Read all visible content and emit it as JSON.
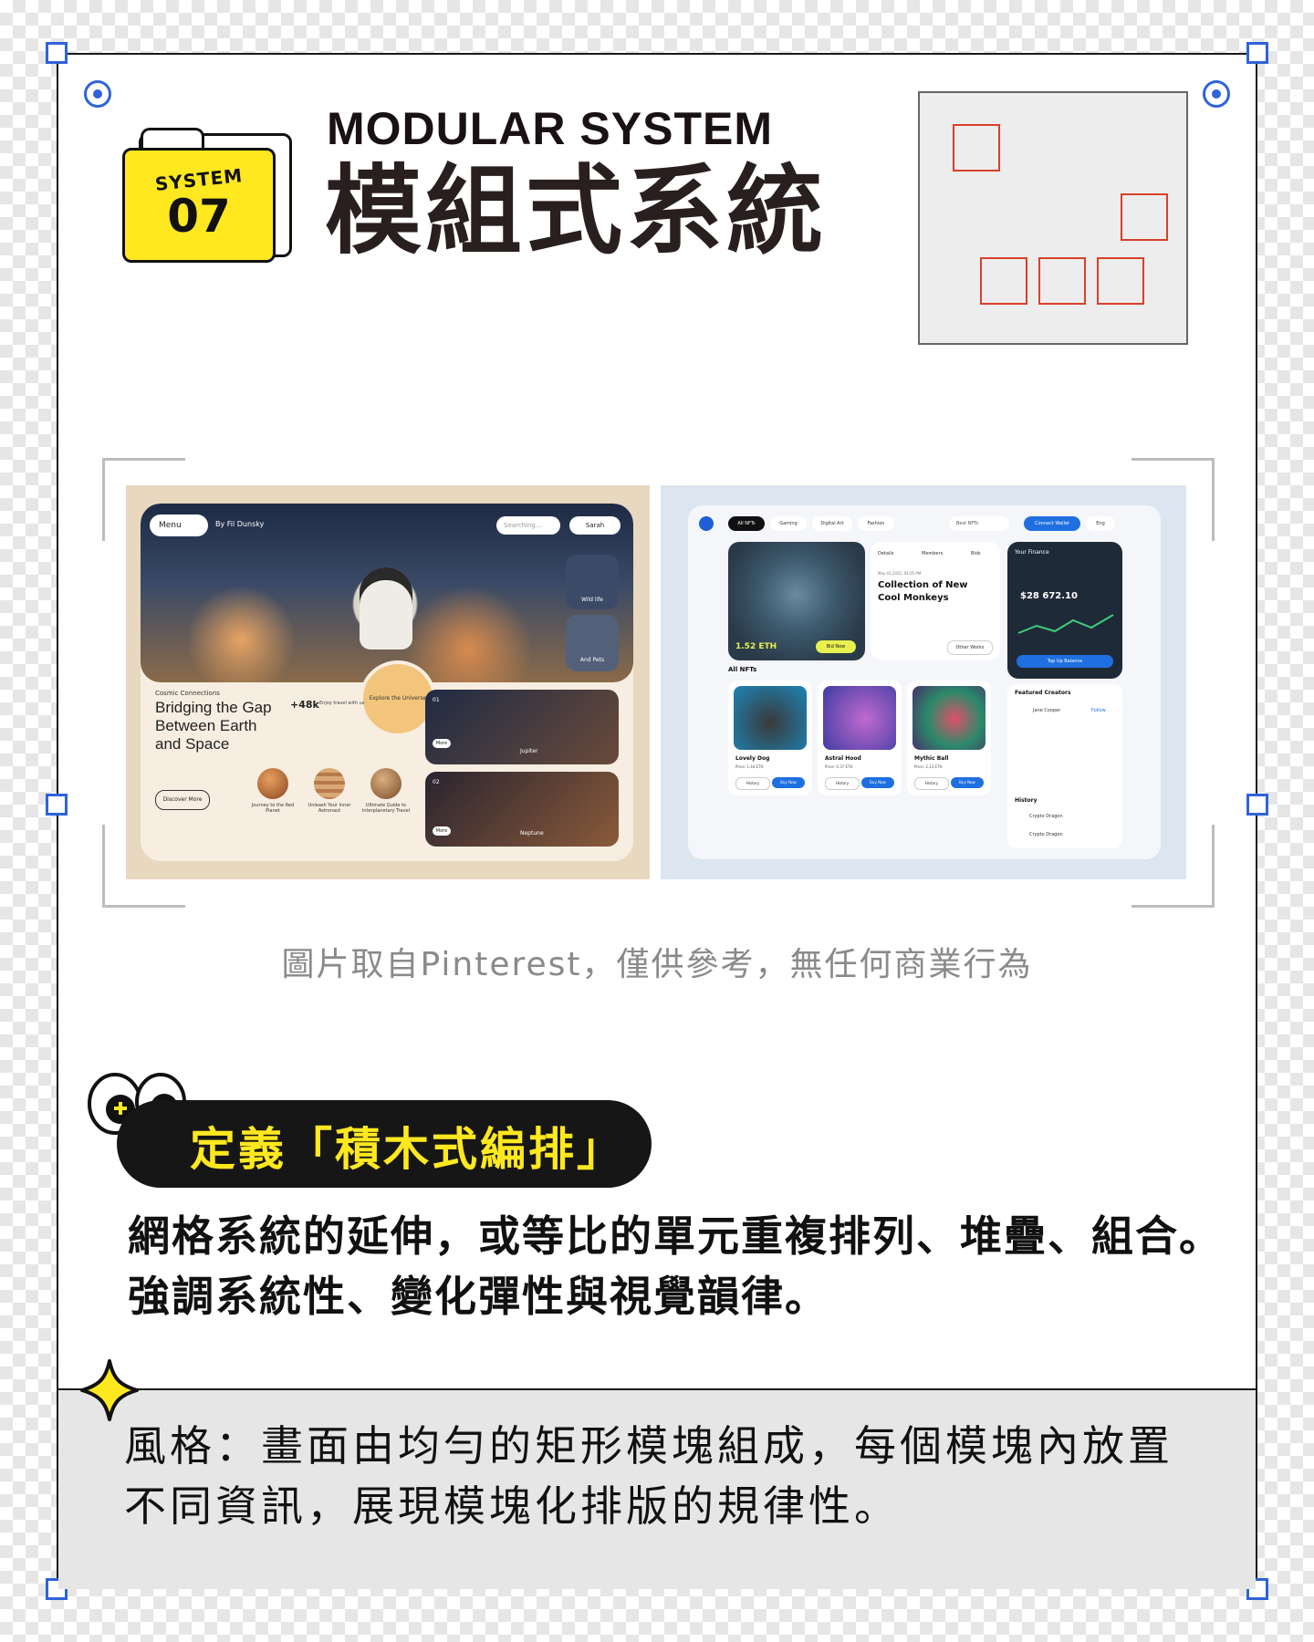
{
  "badge": {
    "line1": "SYSTEM",
    "line2": "07"
  },
  "title": {
    "english": "MODULAR SYSTEM",
    "chinese": "模組式系統"
  },
  "reference_images": {
    "left": {
      "menu": "Menu",
      "brand": "By Fil Dunsky",
      "search_placeholder": "Searching...",
      "user": "Sarah",
      "kicker": "Cosmic Connections",
      "headline_1": "Bridging the Gap",
      "headline_2": "Between Earth",
      "headline_3": "and Space",
      "stat": "+48k",
      "stat_text": "Enjoy travel with us",
      "button": "Discover More",
      "circle_text": "Explore the Universe",
      "card1_no": "01",
      "card1_label": "Jupiter",
      "card2_no": "02",
      "card2_label": "Neptune",
      "card_more": "More",
      "chips": [
        "Wild life",
        "And Pets"
      ],
      "planets": [
        "Journey to the Red Planet",
        "Unleash Your Inner Astronaut",
        "Ultimate Guide to Interplanetary Travel"
      ]
    },
    "right": {
      "nav": [
        "All NFTs",
        "Gaming",
        "Digital Art",
        "Fashion"
      ],
      "search": "Best NFTs",
      "connect": "Connect Wallet",
      "lang": "Eng",
      "tabs": [
        "Details",
        "Members",
        "Bids"
      ],
      "date": "May 01,2022, 04:05 PM",
      "collection_title_1": "Collection of New",
      "collection_title_2": "Cool Monkeys",
      "price": "1.52 ETH",
      "bid": "Bid Now",
      "other_works": "Other Works",
      "finance_title": "Your Finance",
      "balance": "$28 672.10",
      "top_up": "Top Up Balance",
      "all_nfts": "All NFTs",
      "nft_cards": [
        {
          "name": "Lovely Dog",
          "price": "Price: 1.44 ETH"
        },
        {
          "name": "Astral Hood",
          "price": "Price: 0.37 ETH"
        },
        {
          "name": "Mythic Ball",
          "price": "Price: 2.13 ETH"
        }
      ],
      "history_btn": "History",
      "buy_btn": "Buy Now",
      "featured": "Featured Creators",
      "creator": "Jane Cooper",
      "follow": "Follow",
      "history": "History",
      "history_items": [
        "Crypto Dragon",
        "Crypto Dragon"
      ]
    }
  },
  "caption": "圖片取自Pinterest，僅供參考，無任何商業行為",
  "definition": {
    "label": "定義「積木式編排」",
    "line1": "網格系統的延伸，或等比的單元重複排列、堆疊、組合。",
    "line2": "強調系統性、變化彈性與視覺韻律。"
  },
  "style": {
    "line1": "風格：畫面由均勻的矩形模塊組成，每個模塊內放置",
    "line2": "不同資訊，展現模塊化排版的規律性。"
  },
  "colors": {
    "accent_yellow": "#ffe81f",
    "handle_blue": "#2f63d8",
    "module_red": "#d9402a"
  }
}
